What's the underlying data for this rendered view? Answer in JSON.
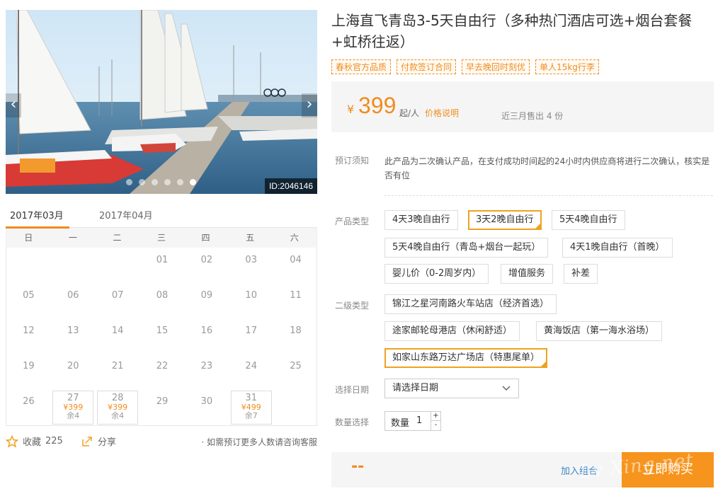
{
  "gallery": {
    "image_id": "ID:2046146",
    "prev_icon": "chevron-left-icon",
    "next_icon": "chevron-right-icon",
    "dot_count": 6,
    "active_dot": 5
  },
  "calendar": {
    "tabs": [
      "2017年03月",
      "2017年04月"
    ],
    "weekdays": [
      "日",
      "一",
      "二",
      "三",
      "四",
      "五",
      "六"
    ],
    "weeks": [
      [
        {
          "d": ""
        },
        {
          "d": ""
        },
        {
          "d": ""
        },
        {
          "d": "01"
        },
        {
          "d": "02"
        },
        {
          "d": "03"
        },
        {
          "d": "04"
        }
      ],
      [
        {
          "d": "05"
        },
        {
          "d": "06"
        },
        {
          "d": "07"
        },
        {
          "d": "08"
        },
        {
          "d": "09"
        },
        {
          "d": "10"
        },
        {
          "d": "11"
        }
      ],
      [
        {
          "d": "12"
        },
        {
          "d": "13"
        },
        {
          "d": "14"
        },
        {
          "d": "15"
        },
        {
          "d": "16"
        },
        {
          "d": "17"
        },
        {
          "d": "18"
        }
      ],
      [
        {
          "d": "19"
        },
        {
          "d": "20"
        },
        {
          "d": "21"
        },
        {
          "d": "22"
        },
        {
          "d": "23"
        },
        {
          "d": "24"
        },
        {
          "d": "25"
        }
      ],
      [
        {
          "d": "26"
        },
        {
          "d": "27",
          "price": "¥399",
          "remain": "余4"
        },
        {
          "d": "28",
          "price": "¥399",
          "remain": "余4"
        },
        {
          "d": "29"
        },
        {
          "d": "30"
        },
        {
          "d": "31",
          "price": "¥499",
          "remain": "余7"
        },
        {
          "d": ""
        }
      ]
    ]
  },
  "social": {
    "favorite_label": "收藏",
    "favorite_count": "225",
    "share_label": "分享",
    "consult_note": "· 如需预订更多人数请咨询客服"
  },
  "product": {
    "title": "上海直飞青岛3-5天自由行（多种热门酒店可选+烟台套餐+虹桥往返）",
    "tags": [
      "春秋官方品质",
      "付款签订合同",
      "早去晚回时刻优",
      "单人15kg行李"
    ]
  },
  "price": {
    "currency": "¥",
    "amount": "399",
    "unit": "起/人",
    "explain_link": "价格说明",
    "sold": "近三月售出 4 份"
  },
  "booking": {
    "notice_label": "预订须知",
    "notice_text": "此产品为二次确认产品，在支付成功时间起的24小时内供应商将进行二次确认，核实是否有位",
    "product_type_label": "产品类型",
    "product_types": [
      "4天3晚自由行",
      "3天2晚自由行",
      "5天4晚自由行",
      "5天4晚自由行（青岛+烟台一起玩）",
      "4天1晚自由行（首晚）",
      "婴儿价（0-2周岁内）",
      "增值服务",
      "补差"
    ],
    "product_type_selected": 1,
    "sub_type_label": "二级类型",
    "sub_types": [
      "锦江之星河南路火车站店（经济首选）",
      "途家邮轮母港店（休闲舒适）",
      "黄海饭店（第一海水浴场）",
      "如家山东路万达广场店（特惠尾单）"
    ],
    "sub_type_selected": 3,
    "date_label": "选择日期",
    "date_placeholder": "请选择日期",
    "qty_label": "数量选择",
    "qty_inner_label": "数量",
    "qty_value": "1",
    "qty_plus": "+",
    "qty_minus": "-"
  },
  "buy": {
    "total": "--",
    "add_combo": "加入组合",
    "buy_now": "立即购买",
    "watermark": "Lv Xing.net"
  },
  "colors": {
    "accent": "#f08c1e",
    "selected_border": "#f0a21e",
    "link_blue": "#3a86c8",
    "buy_button": "#f7941d"
  }
}
